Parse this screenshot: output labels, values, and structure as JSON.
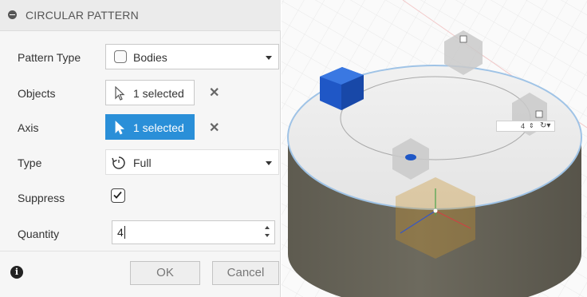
{
  "dialog": {
    "title": "CIRCULAR PATTERN",
    "rows": {
      "pattern_type": {
        "label": "Pattern Type",
        "value": "Bodies"
      },
      "objects": {
        "label": "Objects",
        "value": "1 selected"
      },
      "axis": {
        "label": "Axis",
        "value": "1 selected"
      },
      "type": {
        "label": "Type",
        "value": "Full"
      },
      "suppress": {
        "label": "Suppress",
        "checked": true
      },
      "quantity": {
        "label": "Quantity",
        "value": "4"
      }
    },
    "ok_label": "OK",
    "cancel_label": "Cancel",
    "info_glyph": "i"
  },
  "viewport": {
    "mini_quantity": "4"
  },
  "colors": {
    "accent": "#2a8fd8",
    "body_side": "#68655a",
    "body_top": "#eaeaea",
    "cube": "#1f57c6"
  },
  "icons": [
    "collapse-icon",
    "bodies-icon",
    "chevron-down-icon",
    "cursor-pointer-icon",
    "close-icon",
    "rotate-full-icon",
    "checkbox-icon",
    "spinner-icon",
    "info-icon"
  ]
}
